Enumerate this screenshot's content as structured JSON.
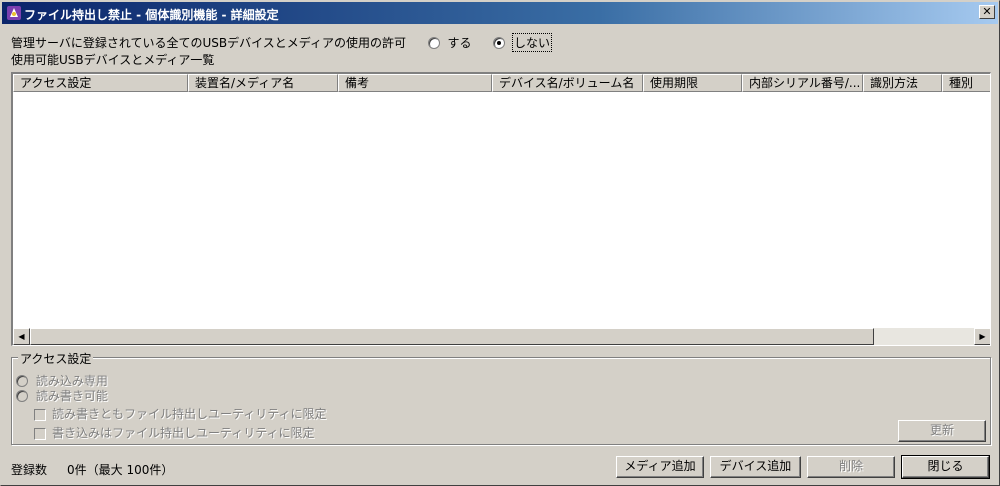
{
  "window": {
    "title": "ファイル持出し禁止 - 個体識別機能 - 詳細設定",
    "close_glyph": "✕"
  },
  "permission": {
    "label": "管理サーバに登録されている全てのUSBデバイスとメディアの使用の許可",
    "option_yes": "する",
    "option_no": "しない",
    "selected": "しない"
  },
  "list": {
    "caption": "使用可能USBデバイスとメディア一覧",
    "columns": [
      "アクセス設定",
      "装置名/メディア名",
      "備考",
      "デバイス名/ボリューム名",
      "使用期限",
      "内部シリアル番号/...",
      "識別方法",
      "種別"
    ],
    "rows": [],
    "scroll_left_glyph": "◀",
    "scroll_right_glyph": "▶"
  },
  "access": {
    "group_title": "アクセス設定",
    "read_only": "読み込み専用",
    "read_write": "読み書き可能",
    "rw_limit": "読み書きともファイル持出しユーティリティに限定",
    "write_limit": "書き込みはファイル持出しユーティリティに限定",
    "update_button": "更新"
  },
  "footer": {
    "count_label": "登録数",
    "count_value": "0件（最大 100件）",
    "add_media": "メディア追加",
    "add_device": "デバイス追加",
    "delete": "削除",
    "close": "閉じる"
  },
  "colors": {
    "face": "#d4d0c8",
    "title_start": "#0a246a",
    "title_end": "#a6caf0",
    "disabled_text": "#808080"
  }
}
